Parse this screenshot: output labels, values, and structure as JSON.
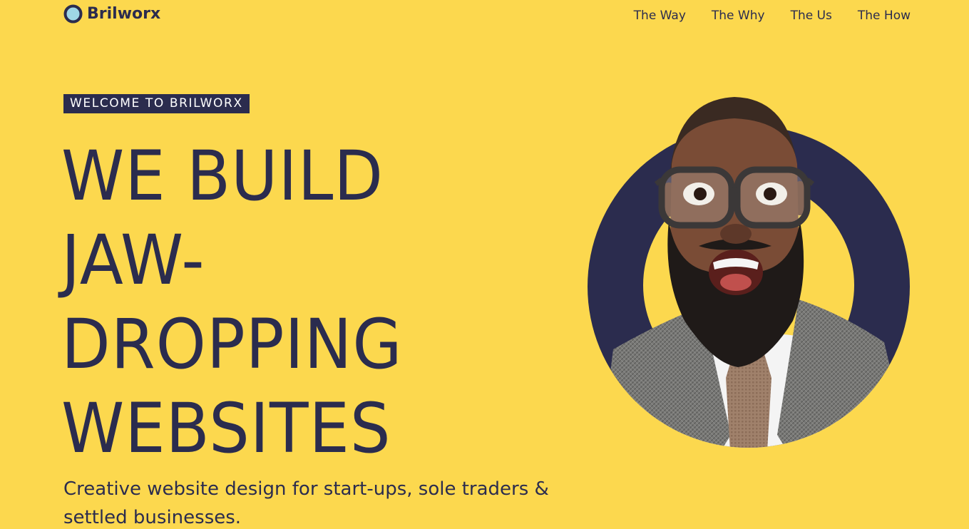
{
  "brand": {
    "name": "Brilworx"
  },
  "nav": {
    "items": [
      {
        "label": "The Way"
      },
      {
        "label": "The Why"
      },
      {
        "label": "The Us"
      },
      {
        "label": "The How"
      }
    ]
  },
  "hero": {
    "badge": "WELCOME TO BRILWORX",
    "headline_lines": [
      "WE BUILD",
      "JAW-",
      "DROPPING",
      "WEBSITES"
    ],
    "subtext": "Creative website design for start-ups, sole traders & settled businesses."
  },
  "colors": {
    "background": "#fcd84e",
    "navy": "#2b2c4e",
    "white": "#ffffff"
  },
  "icons": {
    "logo": "ring-logo-icon",
    "hero_image": "excited-man-with-glasses-photo"
  }
}
